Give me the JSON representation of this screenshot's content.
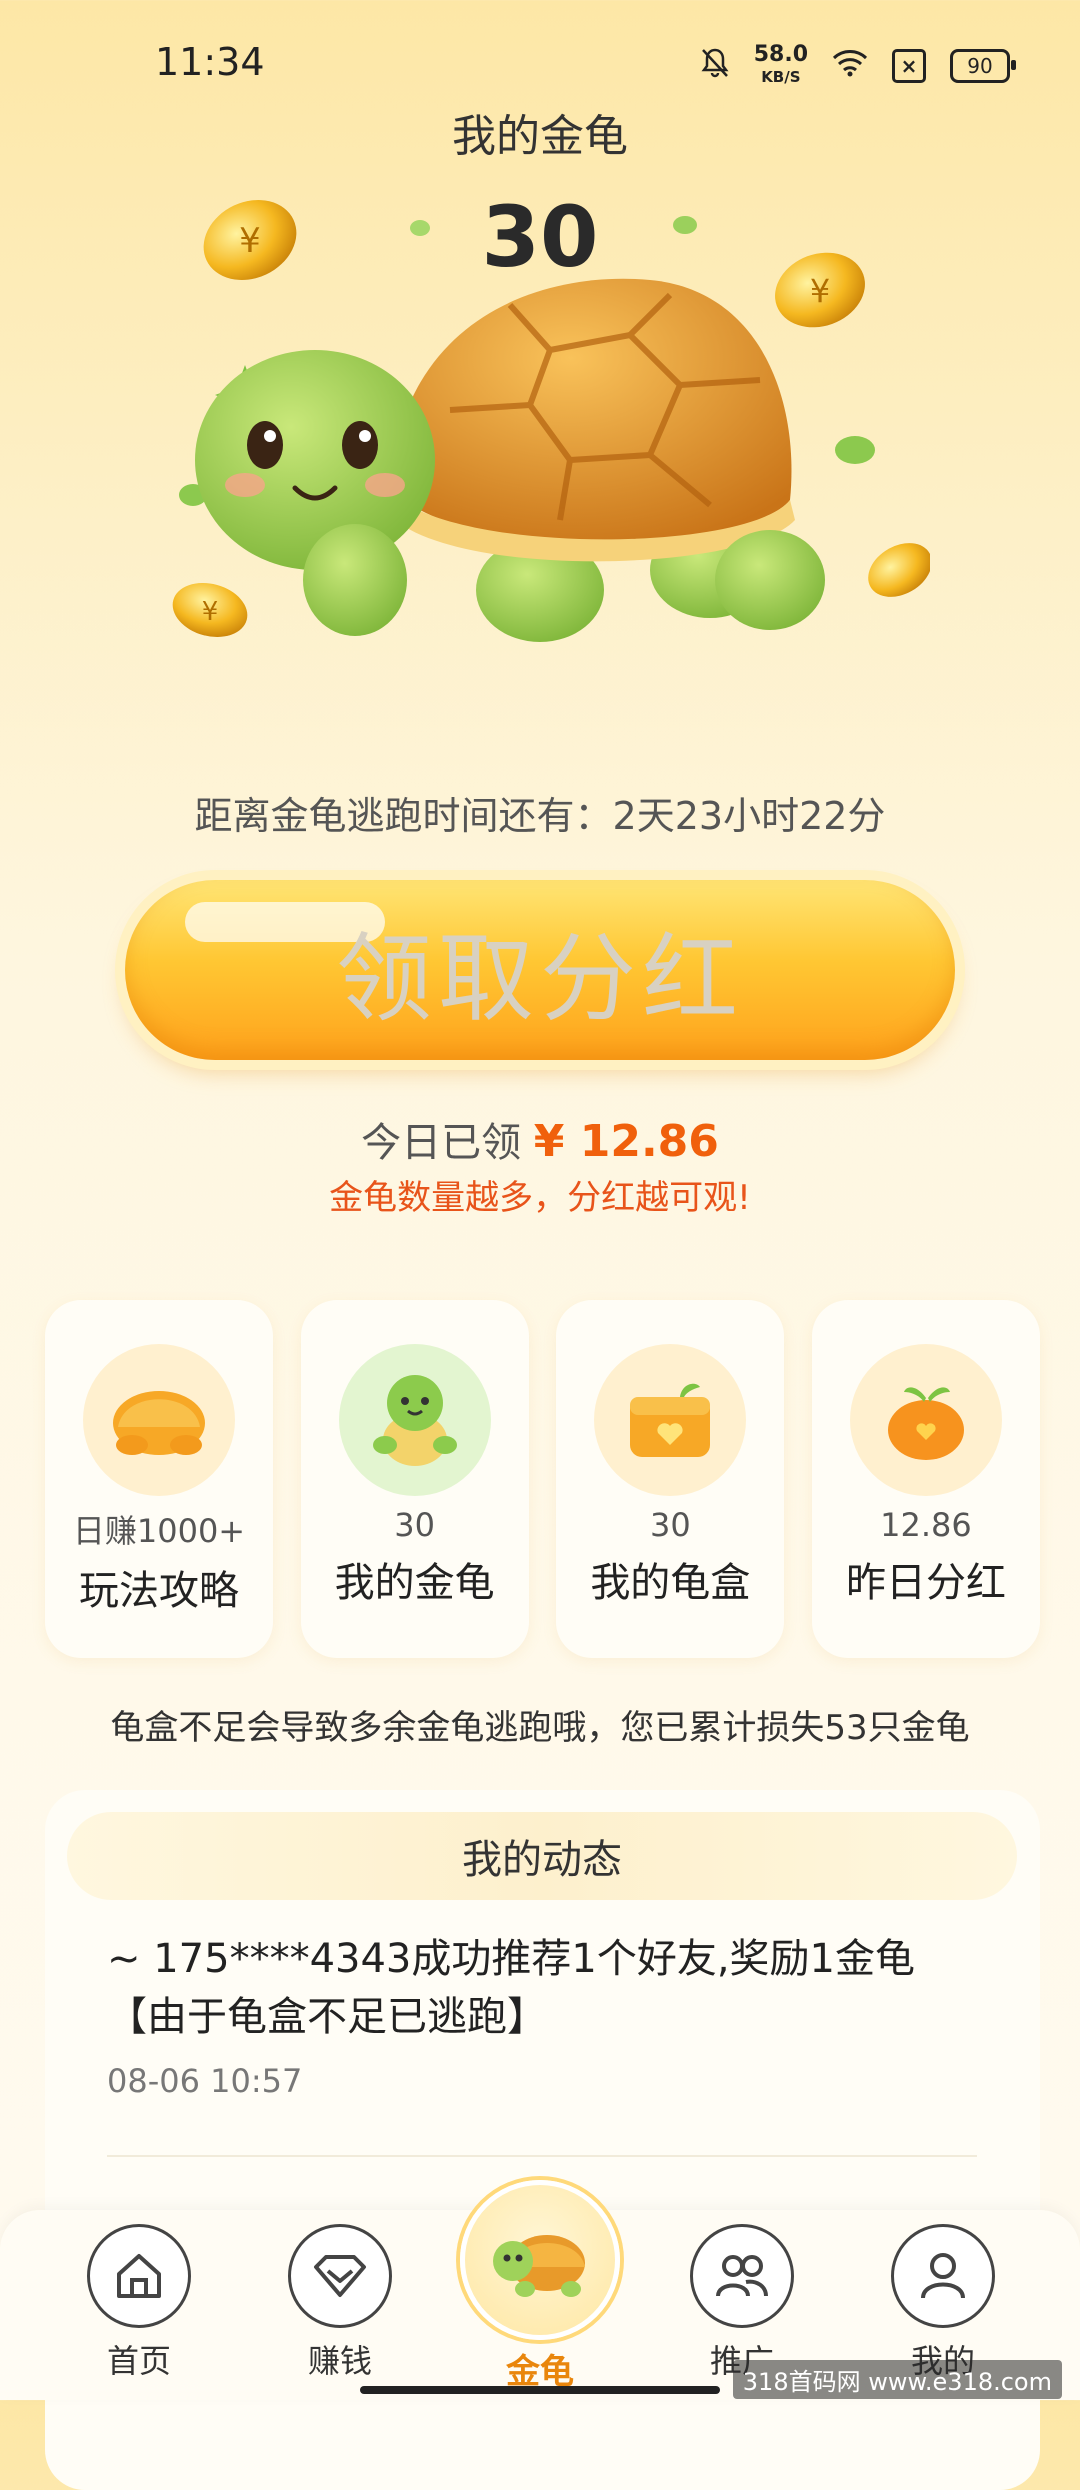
{
  "status_bar": {
    "time": "11:34",
    "speed_value": "58.0",
    "speed_unit": "KB/S",
    "battery": "90"
  },
  "header": {
    "title": "我的金龟",
    "turtle_count": "30"
  },
  "countdown": {
    "text": "距离金龟逃跑时间还有：2天23小时22分"
  },
  "claim_button": {
    "label": "领取分红"
  },
  "today": {
    "prefix": "今日已领",
    "amount": "¥ 12.86",
    "hint": "金龟数量越多，分红越可观!"
  },
  "cards": [
    {
      "sub": "日赚1000+",
      "title": "玩法攻略",
      "icon": "turtle-shell-icon"
    },
    {
      "sub": "30",
      "title": "我的金龟",
      "icon": "green-turtle-icon"
    },
    {
      "sub": "30",
      "title": "我的龟盒",
      "icon": "turtle-box-icon"
    },
    {
      "sub": "12.86",
      "title": "昨日分红",
      "icon": "orange-dividend-icon"
    }
  ],
  "warning": "龟盒不足会导致多余金龟逃跑哦，您已累计损失53只金龟",
  "feed": {
    "title": "我的动态",
    "items": [
      {
        "text": "~ 175****4343成功推荐1个好友,奖励1金龟【由于龟盒不足已逃跑】",
        "time": "08-06 10:57"
      }
    ]
  },
  "nav": {
    "items": [
      {
        "label": "首页",
        "icon": "home-icon"
      },
      {
        "label": "赚钱",
        "icon": "diamond-icon"
      },
      {
        "label": "金龟",
        "icon": "turtle-icon"
      },
      {
        "label": "推广",
        "icon": "people-icon"
      },
      {
        "label": "我的",
        "icon": "user-icon"
      }
    ]
  },
  "watermark": "318首码网 www.e318.com",
  "colors": {
    "accent": "#f0600c",
    "button": "#ffc733",
    "nav_active": "#e9860c"
  }
}
